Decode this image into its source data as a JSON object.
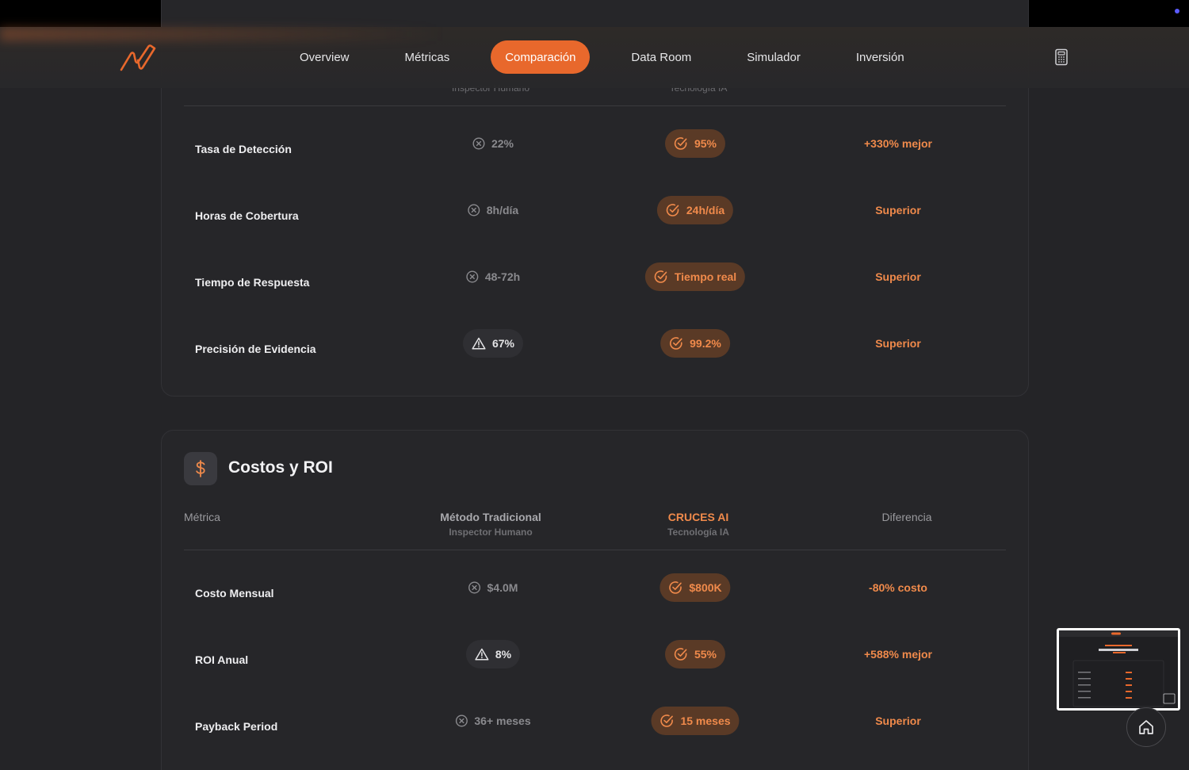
{
  "nav": {
    "items": [
      "Overview",
      "Métricas",
      "Comparación",
      "Data Room",
      "Simulador",
      "Inversión"
    ],
    "active_index": 2
  },
  "partial_header": {
    "trad_sub": "Inspector Humano",
    "ai_sub": "Tecnología IA"
  },
  "performance_rows": [
    {
      "metric": "Tasa de Detección",
      "trad": "22%",
      "trad_icon": "x-circle-icon",
      "ai": "95%",
      "diff": "+330% mejor"
    },
    {
      "metric": "Horas de Cobertura",
      "trad": "8h/día",
      "trad_icon": "x-circle-icon",
      "ai": "24h/día",
      "diff": "Superior"
    },
    {
      "metric": "Tiempo de Respuesta",
      "trad": "48-72h",
      "trad_icon": "x-circle-icon",
      "ai": "Tiempo real",
      "diff": "Superior"
    },
    {
      "metric": "Precisión de Evidencia",
      "trad": "67%",
      "trad_icon": "warning-icon",
      "ai": "99.2%",
      "diff": "Superior"
    }
  ],
  "costs_section": {
    "title": "Costos y ROI",
    "icon": "dollar-icon",
    "headers": {
      "metric": "Métrica",
      "trad": "Método Tradicional",
      "trad_sub": "Inspector Humano",
      "ai": "CRUCES AI",
      "ai_sub": "Tecnología IA",
      "diff": "Diferencia"
    },
    "rows": [
      {
        "metric": "Costo Mensual",
        "trad": "$4.0M",
        "trad_icon": "x-circle-icon",
        "ai": "$800K",
        "diff": "-80% costo"
      },
      {
        "metric": "ROI Anual",
        "trad": "8%",
        "trad_icon": "warning-icon",
        "ai": "55%",
        "diff": "+588% mejor"
      },
      {
        "metric": "Payback Period",
        "trad": "36+ meses",
        "trad_icon": "x-circle-icon",
        "ai": "15 meses",
        "diff": "Superior"
      }
    ]
  },
  "colors": {
    "accent": "#e8682c",
    "accent_text": "#f08a4b",
    "background": "#242427"
  }
}
